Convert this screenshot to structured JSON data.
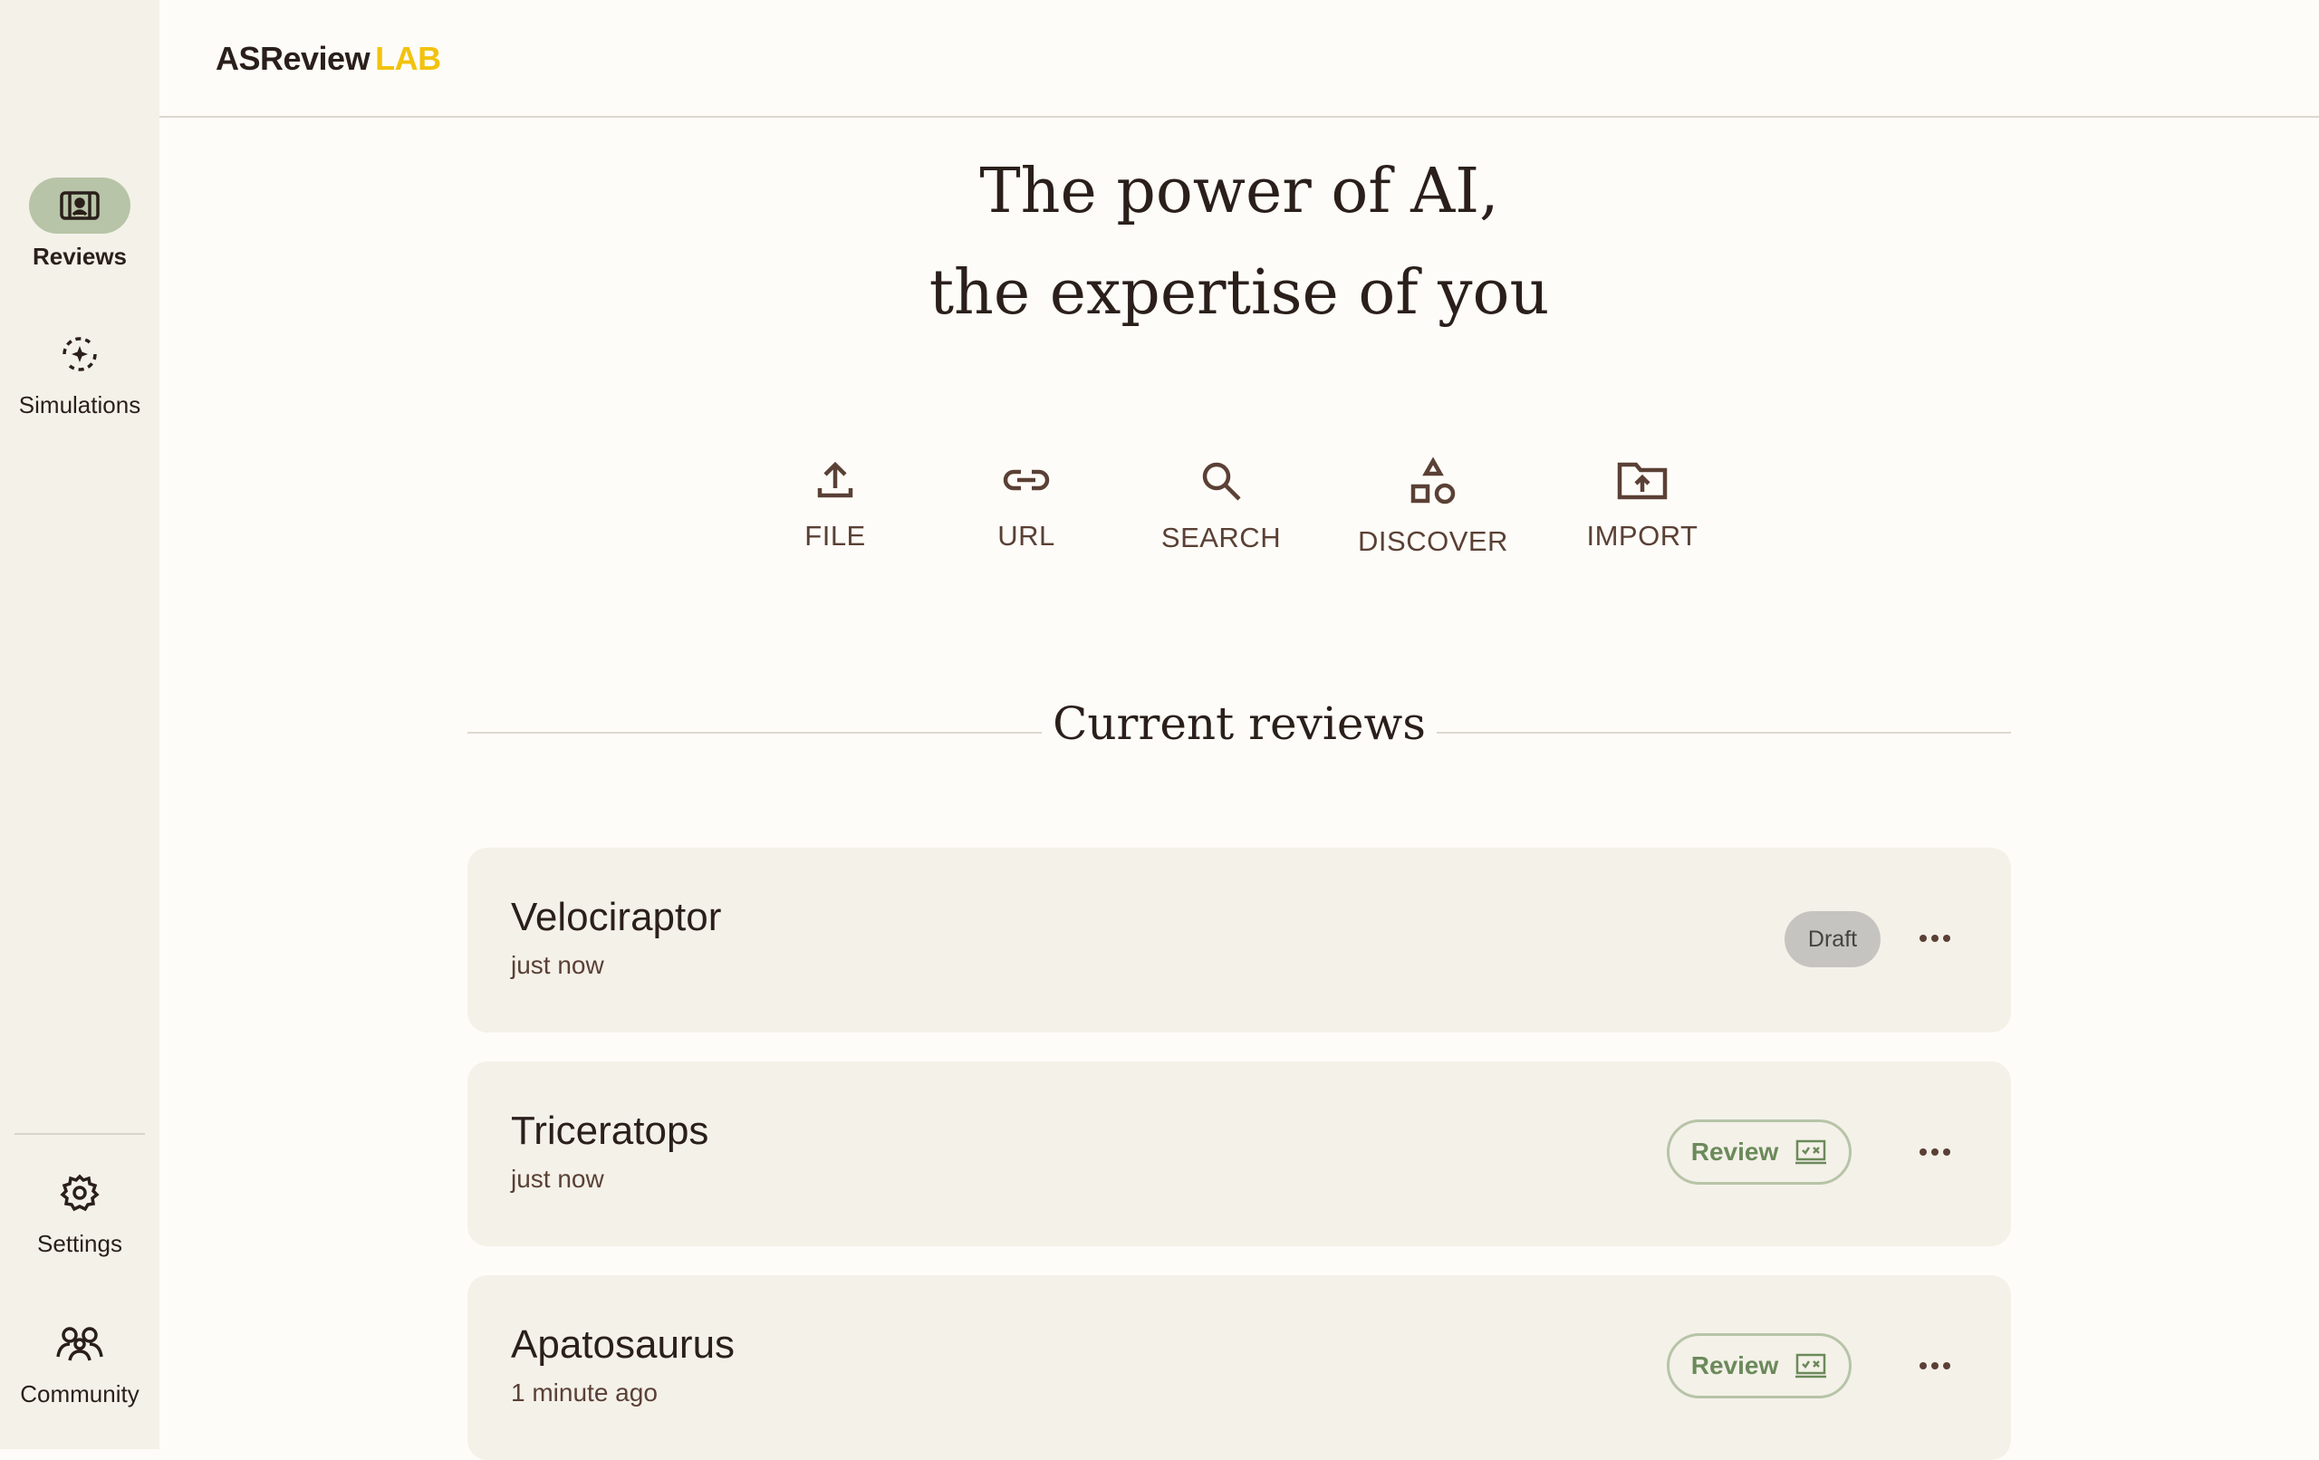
{
  "app": {
    "logo_primary": "ASReview",
    "logo_accent": "LAB"
  },
  "sidebar": {
    "items": [
      {
        "label": "Reviews",
        "icon": "reviews-icon",
        "active": true
      },
      {
        "label": "Simulations",
        "icon": "simulations-icon",
        "active": false
      },
      {
        "label": "Settings",
        "icon": "gear-icon",
        "active": false
      },
      {
        "label": "Community",
        "icon": "community-icon",
        "active": false
      }
    ]
  },
  "hero": {
    "line1": "The power of AI,",
    "line2": "the expertise of you"
  },
  "actions": [
    {
      "label": "FILE",
      "icon": "upload-icon"
    },
    {
      "label": "URL",
      "icon": "link-icon"
    },
    {
      "label": "SEARCH",
      "icon": "search-icon"
    },
    {
      "label": "DISCOVER",
      "icon": "shapes-icon"
    },
    {
      "label": "IMPORT",
      "icon": "folder-upload-icon"
    }
  ],
  "section": {
    "title": "Current reviews"
  },
  "reviews": [
    {
      "title": "Velociraptor",
      "time": "just now",
      "status": "Draft"
    },
    {
      "title": "Triceratops",
      "time": "just now",
      "action": "Review"
    },
    {
      "title": "Apatosaurus",
      "time": "1 minute ago",
      "action": "Review"
    }
  ],
  "colors": {
    "accent": "#f2c20e",
    "active_nav": "#b7c4a7",
    "review_green": "#6b8a5a",
    "icon_brown": "#5a4035"
  }
}
